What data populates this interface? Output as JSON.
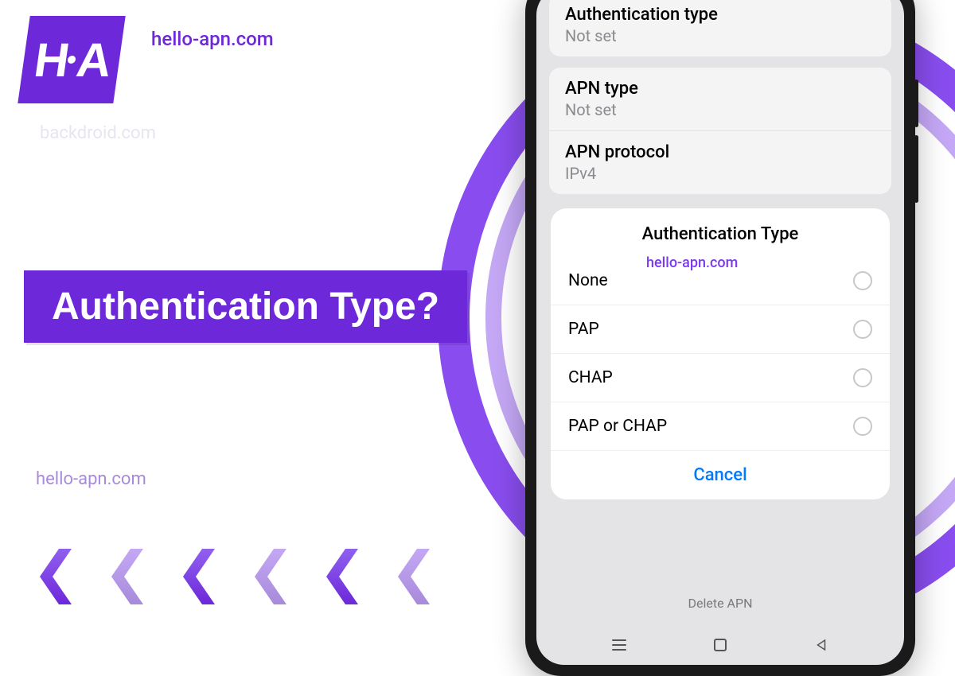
{
  "brand": {
    "logo_left": "H",
    "logo_right": "A",
    "site": "hello-apn.com"
  },
  "watermarks": {
    "faded": "backdroid.com",
    "bottom": "hello-apn.com",
    "modal": "hello-apn.com"
  },
  "banner": {
    "title": "Authentication Type?"
  },
  "phone": {
    "settings": [
      {
        "label": "Authentication type",
        "value": "Not set"
      },
      {
        "label": "APN type",
        "value": "Not set"
      },
      {
        "label": "APN protocol",
        "value": "IPv4"
      }
    ],
    "modal": {
      "title": "Authentication Type",
      "options": [
        "None",
        "PAP",
        "CHAP",
        "PAP or CHAP"
      ],
      "cancel": "Cancel"
    },
    "delete_label": "Delete APN"
  }
}
